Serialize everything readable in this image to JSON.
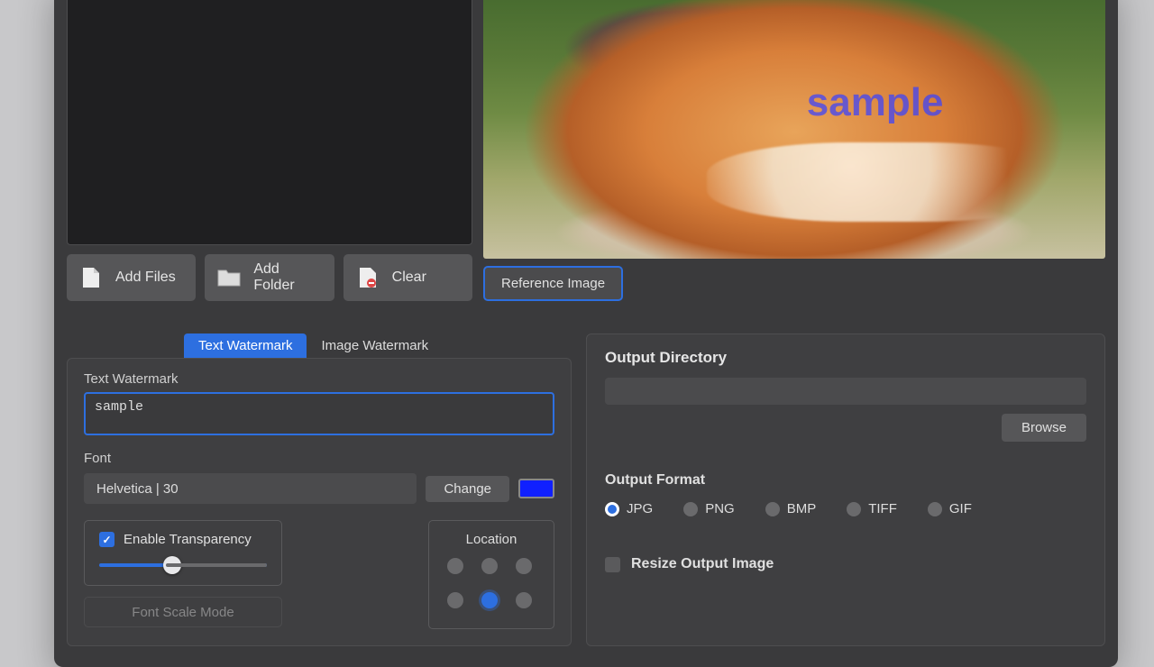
{
  "preview": {
    "watermark_overlay": "sample"
  },
  "file_buttons": {
    "add_files": "Add Files",
    "add_folder": "Add Folder",
    "clear": "Clear"
  },
  "reference_image_btn": "Reference Image",
  "tabs": {
    "text": "Text Watermark",
    "image": "Image Watermark",
    "active": "text"
  },
  "text_watermark": {
    "label": "Text Watermark",
    "value": "sample",
    "font_label": "Font",
    "font_display": "Helvetica | 30",
    "change_btn": "Change",
    "color_hex": "#1020ff",
    "enable_transparency_label": "Enable Transparency",
    "enable_transparency_checked": true,
    "transparency_value": 40,
    "font_scale_mode_label": "Font Scale Mode",
    "location_label": "Location",
    "location_selected_index": 4
  },
  "output": {
    "directory_label": "Output Directory",
    "directory_value": "",
    "browse_btn": "Browse",
    "format_label": "Output Format",
    "formats": [
      "JPG",
      "PNG",
      "BMP",
      "TIFF",
      "GIF"
    ],
    "format_selected": "JPG",
    "resize_label": "Resize Output Image",
    "resize_checked": false
  }
}
